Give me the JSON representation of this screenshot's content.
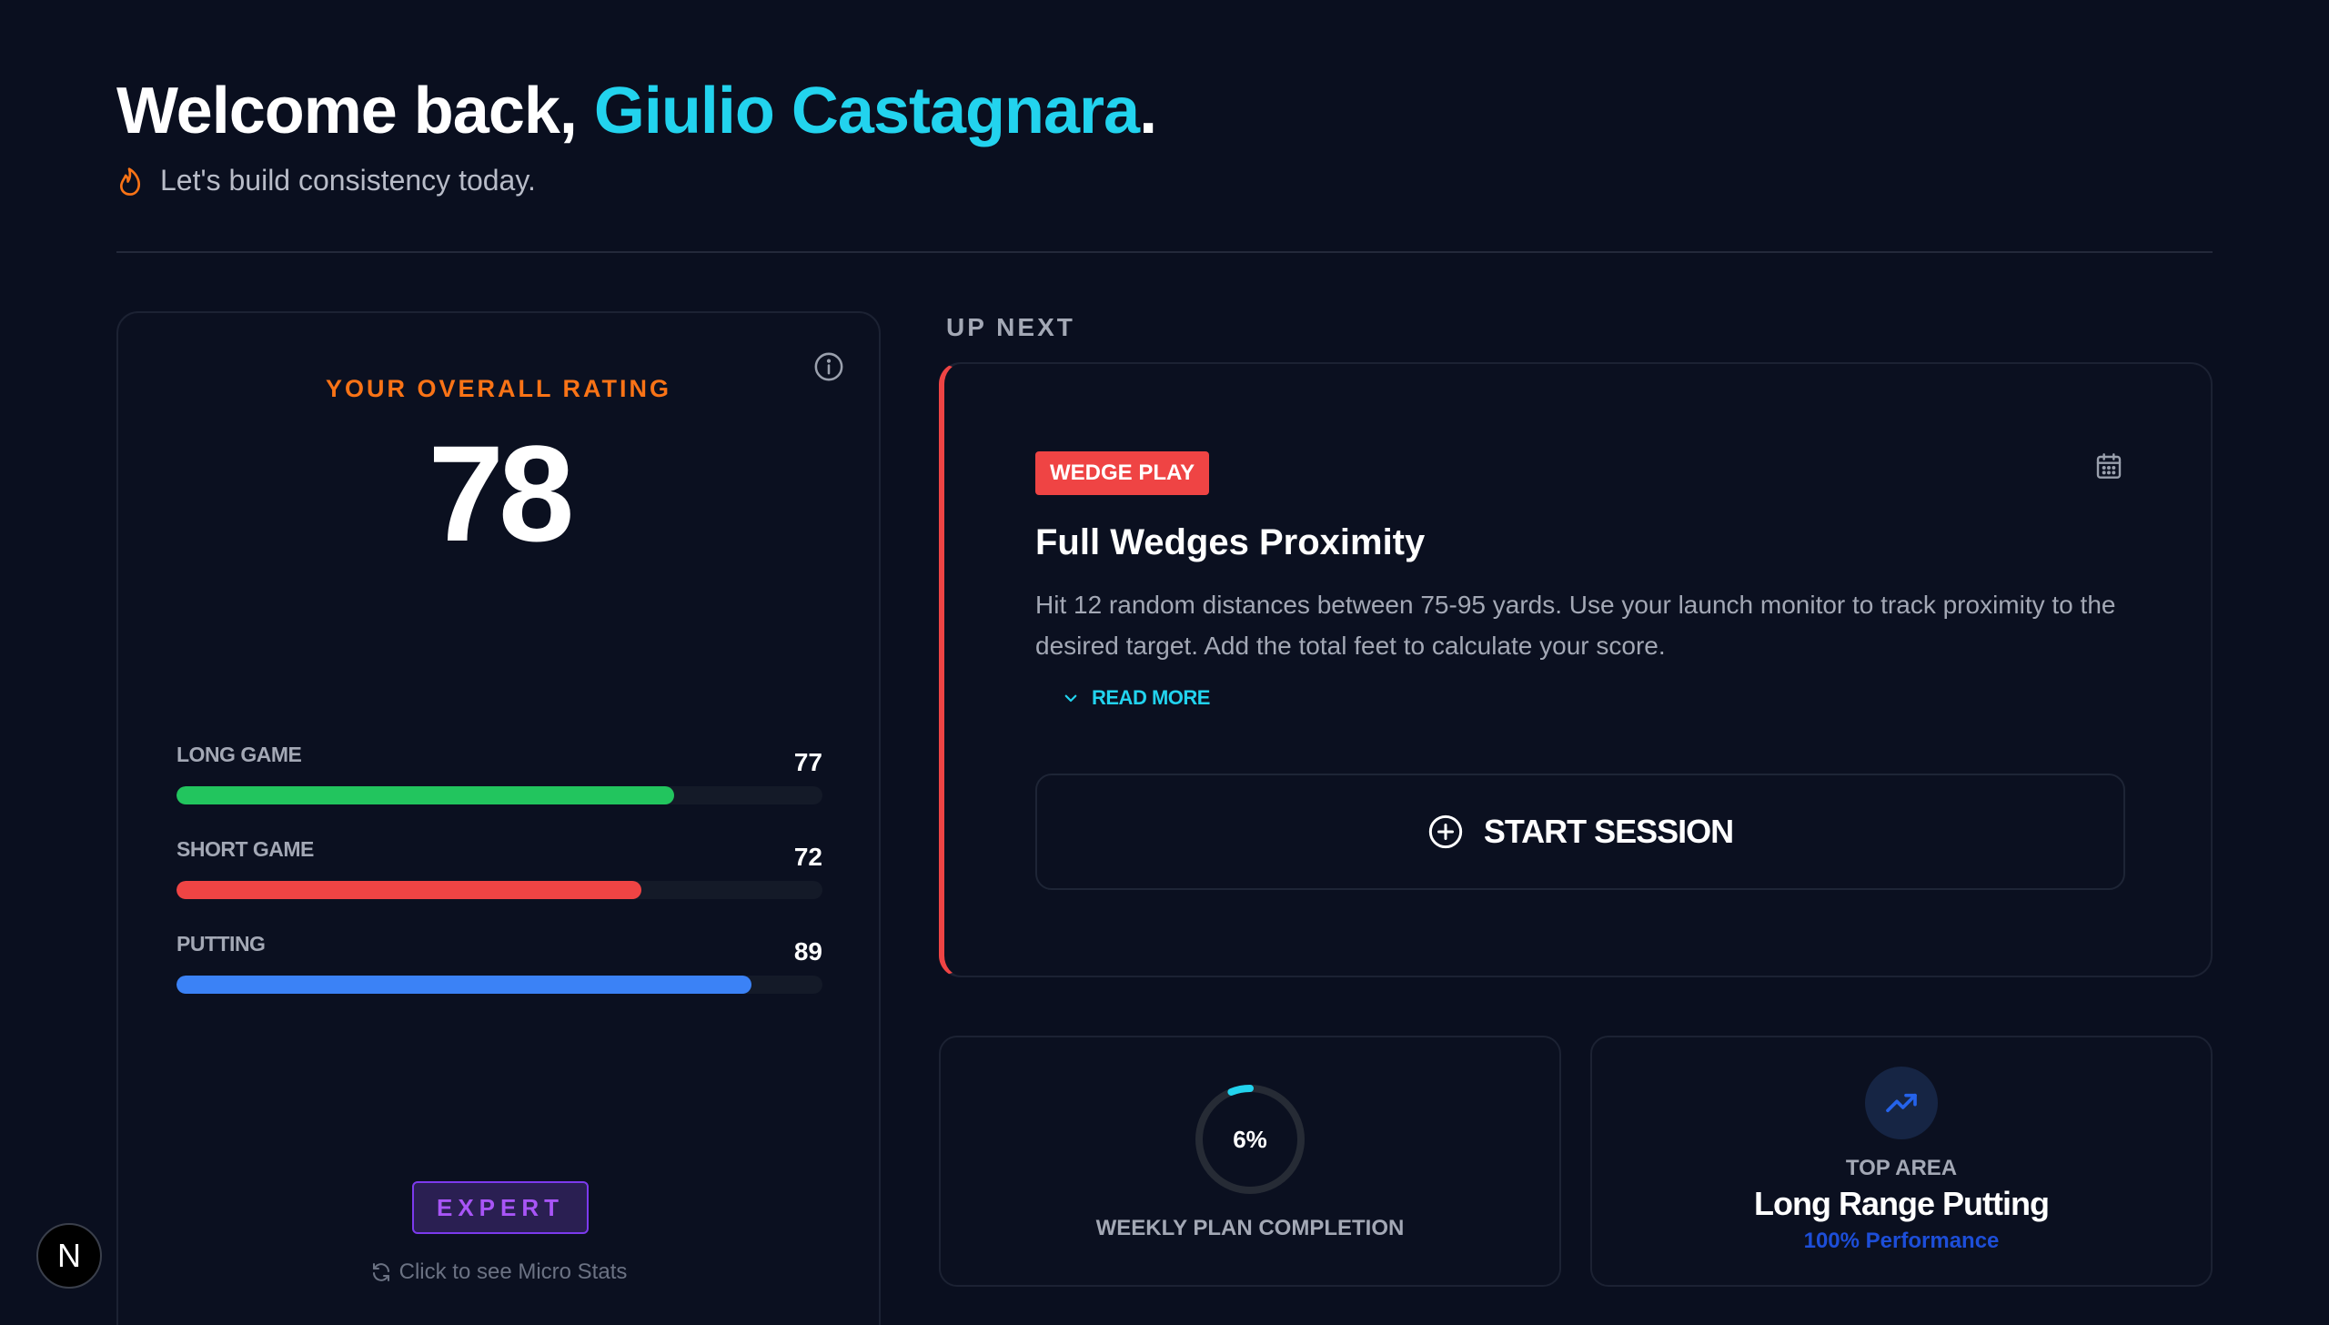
{
  "header": {
    "greeting_prefix": "Welcome back, ",
    "user_name": "Giulio Castagnara",
    "greeting_suffix": ".",
    "subtitle": "Let's build consistency today.",
    "flame_icon": "flame-icon"
  },
  "rating": {
    "label": "YOUR OVERALL RATING",
    "value": "78",
    "info_icon": "info-icon",
    "stats": [
      {
        "name": "LONG GAME",
        "value": "77",
        "fill_fraction": 0.77,
        "color": "#22c55e"
      },
      {
        "name": "SHORT GAME",
        "value": "72",
        "fill_fraction": 0.72,
        "color": "#ef4444"
      },
      {
        "name": "PUTTING",
        "value": "89",
        "fill_fraction": 0.89,
        "color": "#3b82f6"
      }
    ],
    "level": "EXPERT",
    "micro_stats_link": "Click to see Micro Stats"
  },
  "up_next": {
    "label": "UP NEXT",
    "category": "WEDGE PLAY",
    "title": "Full Wedges Proximity",
    "description": "Hit 12 random distances between 75-95 yards. Use your launch monitor to track proximity to the desired target. Add the total feet to calculate your score.",
    "read_more": "READ MORE",
    "start_button": "START SESSION",
    "accent": "#ef4444"
  },
  "weekly": {
    "percent_label": "6%",
    "percent_value": 6,
    "caption": "WEEKLY PLAN COMPLETION",
    "accent": "#22d3ee"
  },
  "top_area": {
    "label": "TOP AREA",
    "name": "Long Range Putting",
    "performance": "100% Performance",
    "icon": "trending-up-icon"
  },
  "floating_button": {
    "label": "N"
  }
}
